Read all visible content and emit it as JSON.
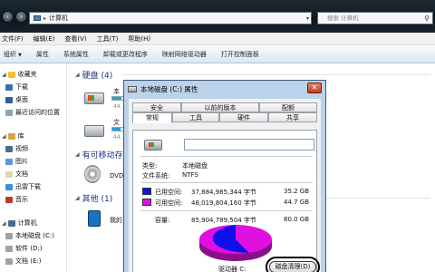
{
  "window": {
    "crumb_root": "▸",
    "crumb_computer": "计算机",
    "search_placeholder": "搜索 计算机"
  },
  "menu": [
    "文件(F)",
    "编辑(E)",
    "查看(V)",
    "工具(T)",
    "帮助(H)"
  ],
  "toolbar": [
    "组织",
    "属性",
    "系统属性",
    "卸载或更改程序",
    "映射网络驱动器",
    "打开控制面板"
  ],
  "sidebar": {
    "favorites": "收藏夹",
    "downloads": "下载",
    "desktop": "桌面",
    "recent": "最近访问的位置",
    "libraries": "库",
    "videos": "视频",
    "pictures": "图片",
    "documents": "文档",
    "thunder": "迅雷下载",
    "music": "音乐",
    "computer": "计算机",
    "drive_c": "本地磁盘 (C:)",
    "drive_d": "软件 (D:)",
    "drive_e": "文档 (E:)"
  },
  "content": {
    "hdd_group": "硬盘 (4)",
    "drive1_name": "本",
    "drive1_size": "44.",
    "drive2_name": "文",
    "drive2_size": "44.",
    "removable_group": "有可移动存",
    "dvd_name": "DVD",
    "other_group": "其他 (1)",
    "other_name": "我的"
  },
  "dialog": {
    "title": "本地磁盘 (C:) 属性",
    "close": "✕",
    "tabs_row1": [
      "安全",
      "以前的版本",
      "配额"
    ],
    "tabs_row2": [
      "常规",
      "工具",
      "硬件",
      "共享"
    ],
    "type_label": "类型:",
    "type_value": "本地磁盘",
    "fs_label": "文件系统:",
    "fs_value": "NTFS",
    "used_label": "已用空间:",
    "used_bytes": "37,884,985,344 字节",
    "used_gb": "35.2 GB",
    "free_label": "可用空间:",
    "free_bytes": "48,019,804,160 字节",
    "free_gb": "44.7 GB",
    "cap_label": "容量:",
    "cap_bytes": "85,904,789,504 字节",
    "cap_gb": "80.0 GB",
    "drive_label": "驱动器 C:",
    "cleanup_button": "磁盘清理(D)",
    "used_color": "#1010e8",
    "free_color": "#e010e0",
    "used_fraction": 0.44
  }
}
